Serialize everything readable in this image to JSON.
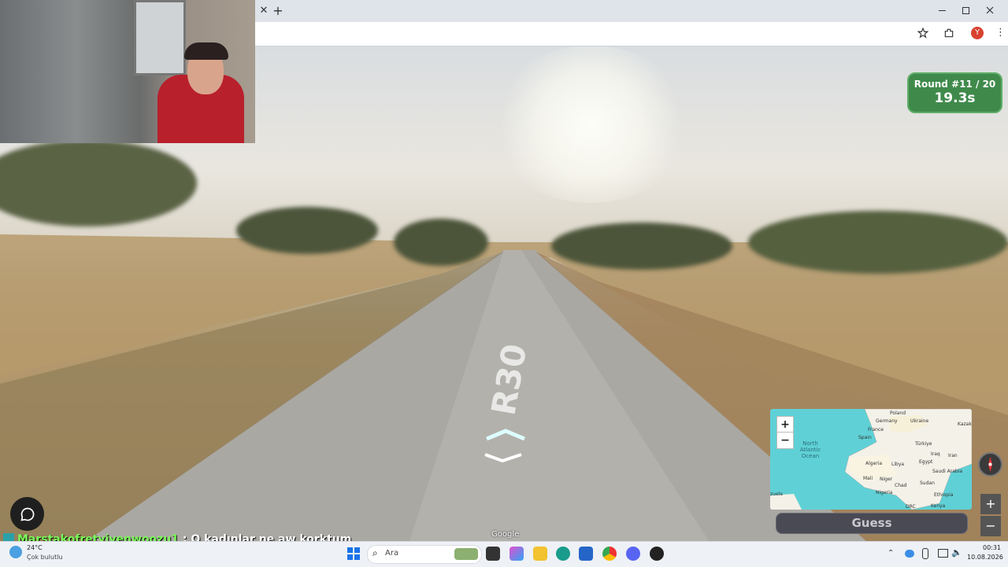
{
  "browser": {
    "tab_close": "✕",
    "new_tab": "+",
    "profile_initial": "Y"
  },
  "game": {
    "round_label": "Round #11 / 20",
    "timer": "19.3s",
    "road_marking": "R30",
    "google_watermark": "Google",
    "guess_label": "Guess",
    "map_zoom_in": "+",
    "map_zoom_out": "−",
    "side_zoom_in": "+",
    "side_zoom_out": "−"
  },
  "map_labels": {
    "poland": "Poland",
    "germany": "Germany",
    "ukraine": "Ukraine",
    "kazak": "Kazak",
    "france": "France",
    "spain": "Spain",
    "turkiye": "Türkiye",
    "north_atlantic_ocean": "North Atlantic Ocean",
    "algeria": "Algeria",
    "libya": "Libya",
    "egypt": "Egypt",
    "iraq": "Iraq",
    "iran": "Iran",
    "mali": "Mali",
    "niger": "Niger",
    "chad": "Chad",
    "sudan": "Sudan",
    "saudi_arabia": "Saudi Arabia",
    "nigeria": "Nigeria",
    "ethiopia": "Ethiopia",
    "kenya": "Kenya",
    "drc": "DRC",
    "zuela": "zuela"
  },
  "chat": {
    "username": "Marstakofretyiyenwoozu1",
    "separator": ":",
    "message": "O kadınlar ne aw korktum"
  },
  "taskbar": {
    "weather_temp": "24°C",
    "weather_desc": "Çok bulutlu",
    "search_placeholder": "Ara",
    "time": "00:31",
    "date": "10.08.2026"
  },
  "colors": {
    "round_badge": "#3f8a4b",
    "map_water": "#5fd1d6",
    "chat_username": "#7cfc5a"
  }
}
